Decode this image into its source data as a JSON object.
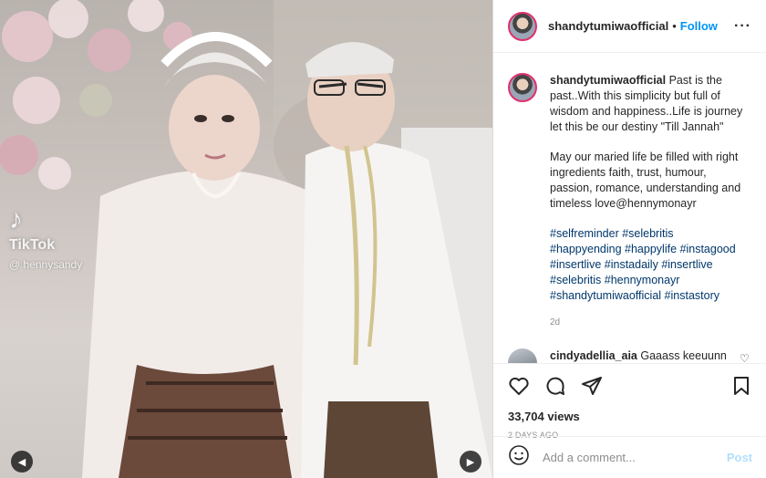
{
  "media": {
    "watermark_logo": "♪",
    "watermark_brand": "TikTok",
    "watermark_handle": "@ hennysandy",
    "prev_icon": "chevron-left-icon",
    "next_icon": "chevron-right-icon"
  },
  "post": {
    "username": "shandytumiwaofficial",
    "dot": "•",
    "follow_label": "Follow",
    "more_label": "···",
    "caption_text_1": "Past is the past..With this simplicity but full of wisdom and happiness..Life is journey let this be our destiny \"Till Jannah\"",
    "caption_text_2": "May our maried life be filled with right ingredients faith, trust, humour, passion, romance, understanding and timeless love@hennymonayr",
    "hashtags": [
      "#selfreminder",
      "#selebritis",
      "#happyending",
      "#happylife",
      "#instagood",
      "#insertlive",
      "#instadaily",
      "#insertlive",
      "#selebritis",
      "#hennymonayr",
      "#shandytumiwaofficial",
      "#instastory"
    ],
    "caption_age": "2d",
    "views": "33,704 views",
    "posted_ago": "2 DAYS AGO"
  },
  "comment": {
    "username": "cindyadellia_aia",
    "text": "Gaaass keeuunn jgn ksh kendooorrr.. cepet ksh"
  },
  "add_comment": {
    "placeholder": "Add a comment...",
    "post_label": "Post"
  },
  "colors": {
    "link": "#0095f6",
    "hashtag": "#00376b",
    "muted": "#8e8e8e",
    "post_disabled": "#b2dffc"
  }
}
